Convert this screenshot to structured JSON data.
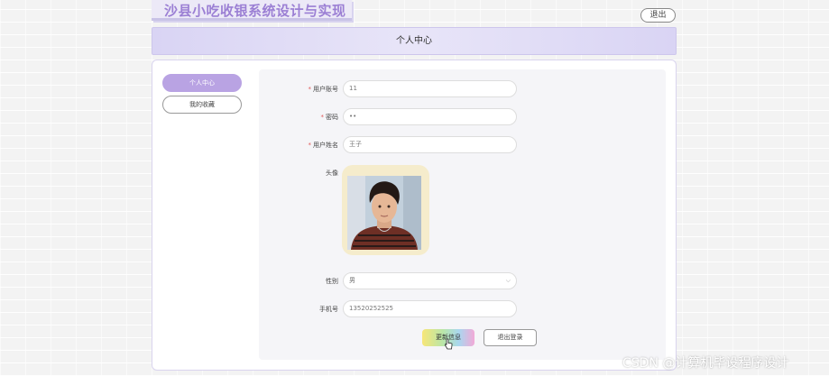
{
  "app": {
    "title": "沙县小吃收银系统设计与实现",
    "logout_label": "退出"
  },
  "header": {
    "title": "个人中心"
  },
  "sidebar": {
    "items": [
      {
        "label": "个人中心",
        "active": true
      },
      {
        "label": "我的收藏",
        "active": false
      }
    ]
  },
  "form": {
    "username": {
      "label": "用户账号",
      "value": "11"
    },
    "password": {
      "label": "密码",
      "value": "••"
    },
    "name": {
      "label": "用户姓名",
      "value": "王子"
    },
    "avatar": {
      "label": "头像"
    },
    "gender": {
      "label": "性别",
      "value": "男"
    },
    "phone": {
      "label": "手机号",
      "value": "13520252525"
    },
    "update_button": "更新信息",
    "logout_button": "退出登录"
  },
  "watermark": "CSDN @计算机毕设程序设计",
  "colors": {
    "accent": "#b9a3e3",
    "header_bg": "#d9d4f4",
    "required": "#e05a5a",
    "title": "#9b7fd4"
  },
  "icons": [
    "chevron-down-icon",
    "pointer-cursor-icon"
  ]
}
